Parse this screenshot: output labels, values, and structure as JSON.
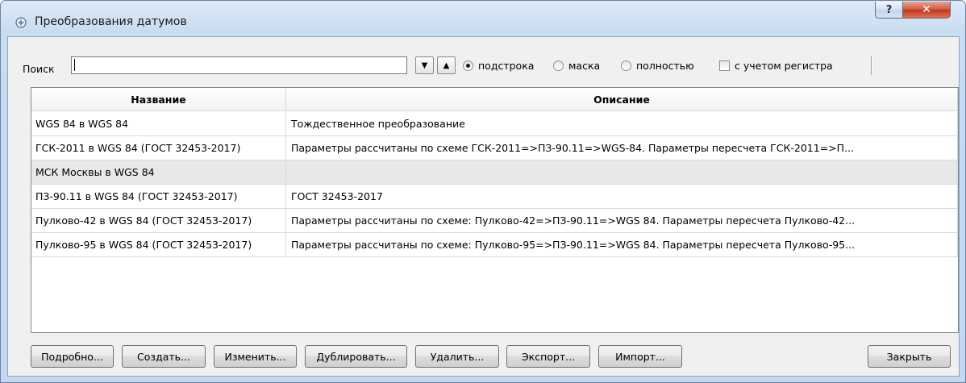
{
  "window": {
    "title": "Преобразования датумов",
    "help_glyph": "?",
    "close_glyph": "✕"
  },
  "search": {
    "label": "Поиск",
    "value": "",
    "down_glyph": "▼",
    "up_glyph": "▲",
    "modes": [
      {
        "label": "подстрока",
        "checked": true
      },
      {
        "label": "маска",
        "checked": false
      },
      {
        "label": "полностью",
        "checked": false
      }
    ],
    "case_label": "с учетом регистра"
  },
  "table": {
    "columns": [
      "Название",
      "Описание"
    ],
    "rows": [
      {
        "name": "WGS 84 в WGS 84",
        "description": "Тождественное преобразование"
      },
      {
        "name": "ГСК-2011 в WGS 84 (ГОСТ 32453-2017)",
        "description": "Параметры рассчитаны по схеме ГСК-2011=>ПЗ-90.11=>WGS-84.  Параметры пересчета ГСК-2011=>П..."
      },
      {
        "name": "МСК Москвы в WGS 84",
        "description": ""
      },
      {
        "name": "ПЗ-90.11 в WGS 84 (ГОСТ 32453-2017)",
        "description": "ГОСТ 32453-2017"
      },
      {
        "name": "Пулково-42 в WGS 84 (ГОСТ 32453-2017)",
        "description": "Параметры рассчитаны по схеме: Пулково-42=>ПЗ-90.11=>WGS 84. Параметры пересчета Пулково-42..."
      },
      {
        "name": "Пулково-95 в WGS 84 (ГОСТ 32453-2017)",
        "description": "Параметры рассчитаны по схеме: Пулково-95=>ПЗ-90.11=>WGS 84. Параметры пересчета Пулково-95..."
      }
    ]
  },
  "buttons": {
    "details": "Подробно...",
    "create": "Создать...",
    "edit": "Изменить...",
    "duplicate": "Дублировать...",
    "delete": "Удалить...",
    "export": "Экспорт...",
    "import": "Импорт...",
    "close": "Закрыть"
  },
  "colors": {
    "selected_row": "#e8e8e8",
    "close_button": "#c1361a"
  }
}
